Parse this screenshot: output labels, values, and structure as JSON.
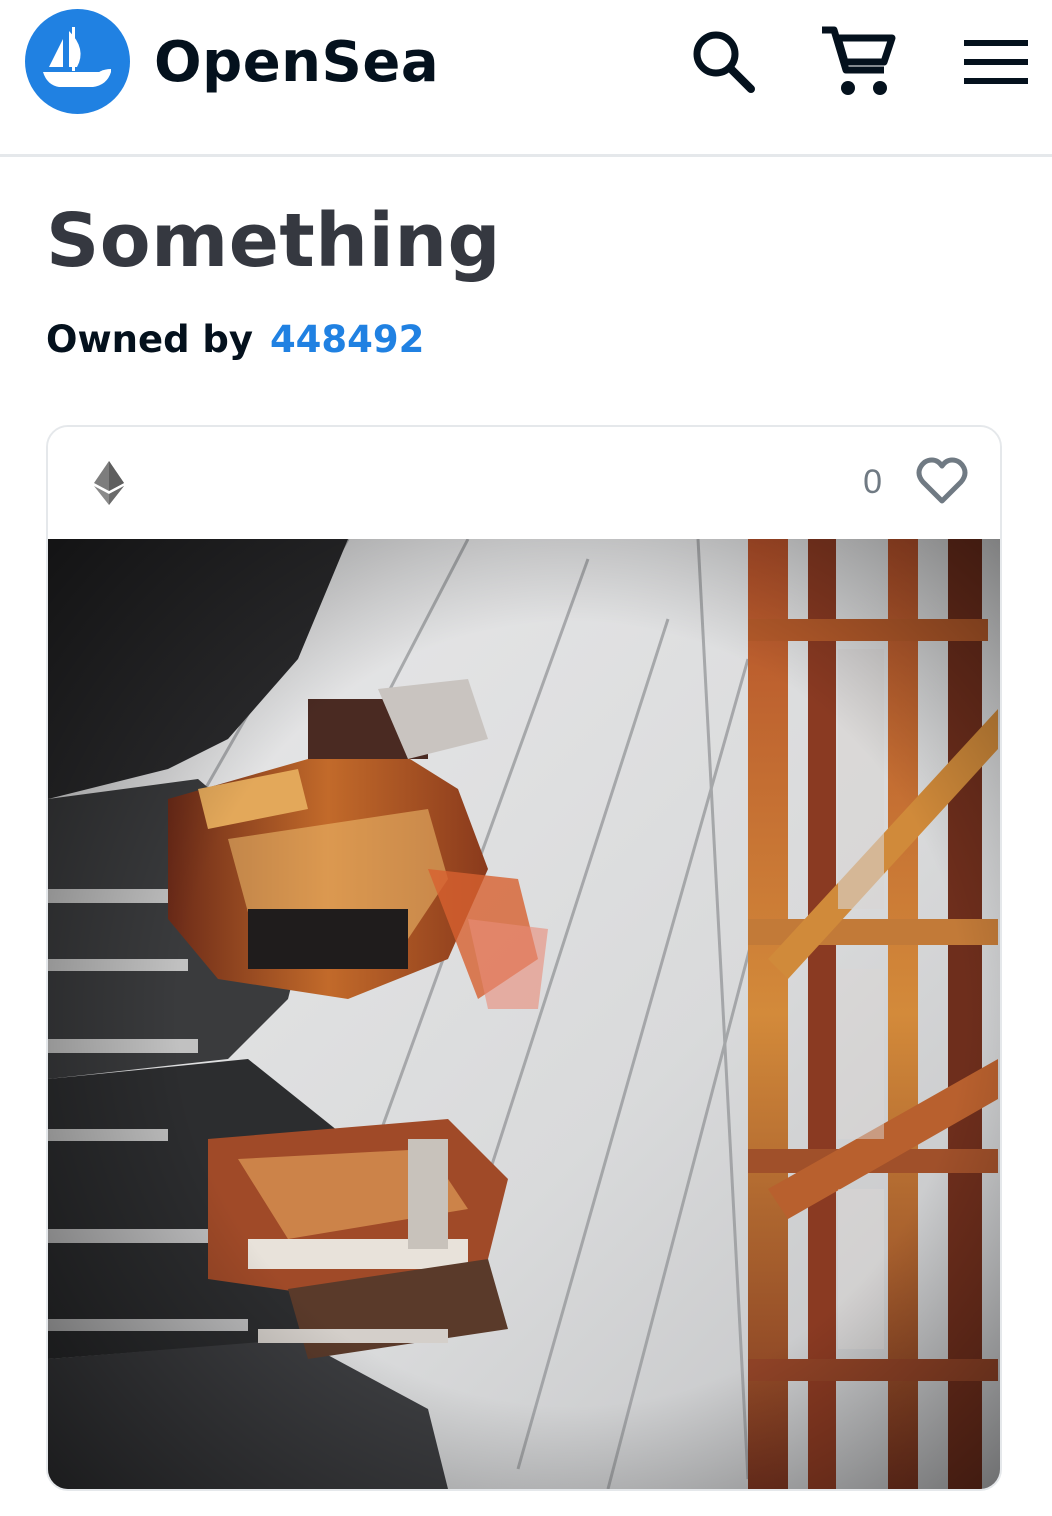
{
  "app": {
    "brand_name": "OpenSea",
    "accent_color": "#2081e2",
    "text_color": "#04111d"
  },
  "header": {
    "icons": [
      "opensea-logo-icon",
      "search-icon",
      "cart-icon",
      "hamburger-menu-icon"
    ]
  },
  "item": {
    "title": "Something",
    "owned_by_label": "Owned by",
    "owner_id": "448492",
    "chain_icon": "ethereum-icon",
    "favorite_count": "0",
    "favorite_icon": "heart-outline-icon",
    "image_description": "Abstract painting of industrial machinery and scaffolding in rust-orange and grey tones"
  }
}
